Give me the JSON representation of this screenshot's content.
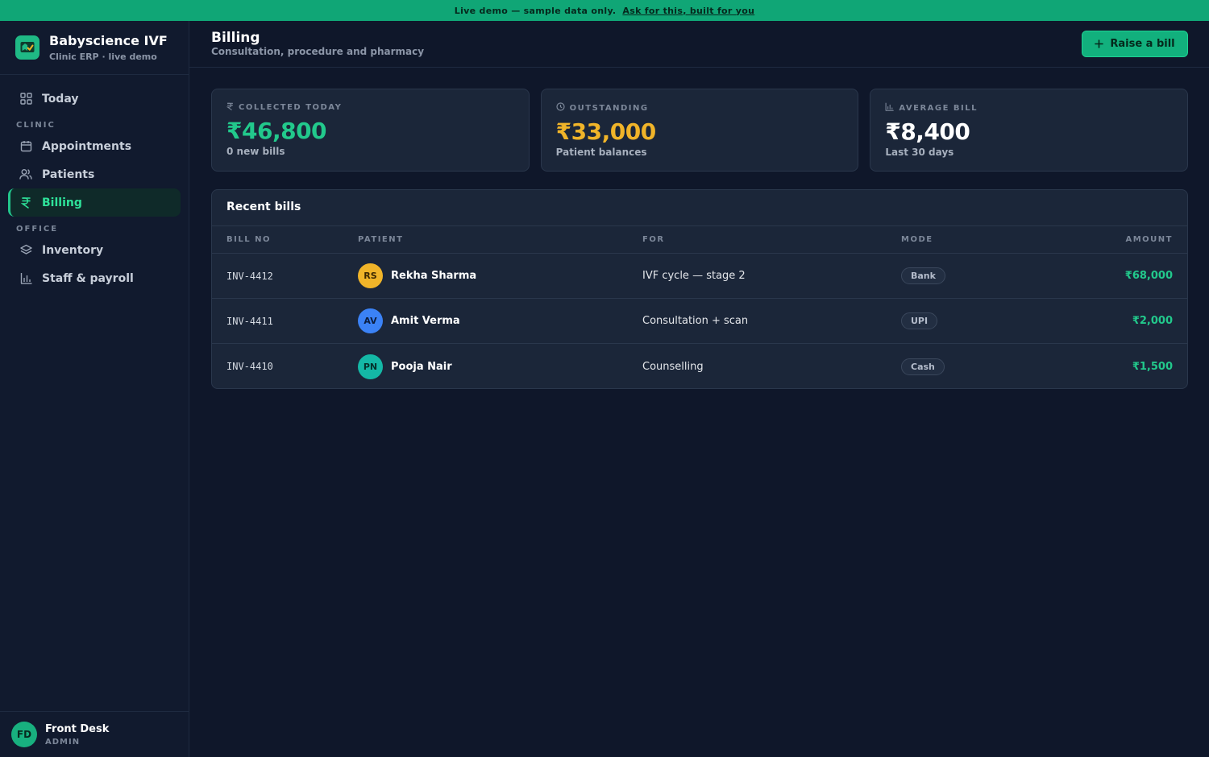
{
  "banner": {
    "text": "Live demo — sample data only.",
    "link": "Ask for this, built for you"
  },
  "brand": {
    "name": "Babyscience IVF",
    "subtitle": "Clinic ERP · live demo"
  },
  "sidebar": {
    "today": "Today",
    "clinic_section": "CLINIC",
    "appointments": "Appointments",
    "patients": "Patients",
    "billing": "Billing",
    "office_section": "OFFICE",
    "inventory": "Inventory",
    "staff": "Staff & payroll"
  },
  "user": {
    "initials": "FD",
    "name": "Front Desk",
    "role": "ADMIN"
  },
  "header": {
    "title": "Billing",
    "subtitle": "Consultation, procedure and pharmacy",
    "raise_button": "Raise a bill"
  },
  "stats": [
    {
      "label": "COLLECTED TODAY",
      "value": "₹46,800",
      "sub": "0 new bills",
      "color": "#22c98c",
      "icon": "rupee-icon"
    },
    {
      "label": "OUTSTANDING",
      "value": "₹33,000",
      "sub": "Patient balances",
      "color": "#f0b429",
      "icon": "clock-icon"
    },
    {
      "label": "AVERAGE BILL",
      "value": "₹8,400",
      "sub": "Last 30 days",
      "color": "#ffffff",
      "icon": "bar-chart-icon"
    }
  ],
  "bills": {
    "title": "Recent bills",
    "columns": {
      "bill_no": "BILL NO",
      "patient": "PATIENT",
      "for": "FOR",
      "mode": "MODE",
      "amount": "AMOUNT"
    },
    "rows": [
      {
        "bill_no": "INV-4412",
        "initials": "RS",
        "avatar_color": "#f0b429",
        "patient": "Rekha Sharma",
        "for": "IVF cycle — stage 2",
        "mode": "Bank",
        "amount": "₹68,000"
      },
      {
        "bill_no": "INV-4411",
        "initials": "AV",
        "avatar_color": "#3b82f6",
        "patient": "Amit Verma",
        "for": "Consultation + scan",
        "mode": "UPI",
        "amount": "₹2,000"
      },
      {
        "bill_no": "INV-4410",
        "initials": "PN",
        "avatar_color": "#14b8a6",
        "patient": "Pooja Nair",
        "for": "Counselling",
        "mode": "Cash",
        "amount": "₹1,500"
      }
    ]
  }
}
